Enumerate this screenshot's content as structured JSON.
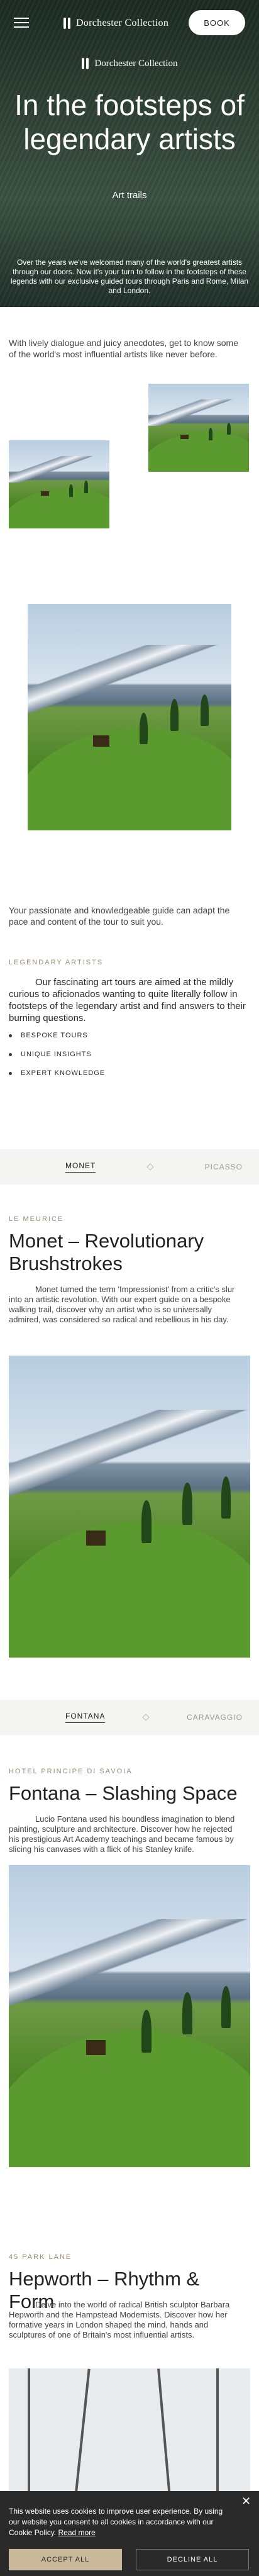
{
  "header": {
    "brand": "Dorchester Collection",
    "book_label": "BOOK",
    "menu_icon": "hamburger-icon"
  },
  "hero": {
    "brand": "Dorchester Collection",
    "title": "In the footsteps of legendary artists",
    "subtitle": "Art trails",
    "description": "Over the years we've welcomed many of the world's greatest artists through our doors. Now it's your turn to follow in the footsteps of these legends with our exclusive guided tours through Paris and Rome, Milan and London."
  },
  "intro": "With lively dialogue and juicy anecdotes, get to know some of the world's most influential artists like never before.",
  "guide_text": "Your passionate and knowledgeable guide can adapt the pace and content of the tour to suit you.",
  "legendary": {
    "kicker": "LEGENDARY ARTISTS",
    "text": "Our fascinating art tours are aimed at the mildly curious to aficionados wanting to quite literally follow in footsteps of the legendary artist and find answers to their burning questions.",
    "features": [
      "BESPOKE TOURS",
      "UNIQUE INSIGHTS",
      "EXPERT KNOWLEDGE"
    ]
  },
  "tabs1": {
    "left": "MONET",
    "right": "PICASSO"
  },
  "monet": {
    "kicker": "LE MEURICE",
    "title": "Monet – Revolutionary Brushstrokes",
    "text": "Monet turned the term 'Impressionist' from a critic's slur into an artistic revolution. With our expert guide on a bespoke walking trail, discover why an artist who is so universally admired, was considered so radical and rebellious in his day."
  },
  "tabs2": {
    "left": "FONTANA",
    "right": "CARAVAGGIO"
  },
  "fontana": {
    "kicker": "HOTEL PRINCIPE DI SAVOIA",
    "title": "Fontana – Slashing Space",
    "text": "Lucio Fontana used his boundless imagination to blend painting, sculpture and architecture. Discover how he rejected his prestigious Art Academy teachings and became famous by slicing his canvases with a flick of his Stanley knife."
  },
  "hepworth": {
    "kicker": "45 PARK LANE",
    "title": "Hepworth – Rhythm & Form",
    "text": "Delve into the world of radical British sculptor Barbara Hepworth and the Hampstead Modernists. Discover how her formative years in London shaped the mind, hands and sculptures of one of Britain's most influential artists."
  },
  "cookie": {
    "text": "This website uses cookies to improve user experience. By using our website you consent to all cookies in accordance with our Cookie Policy.",
    "read_more": "Read more",
    "accept": "ACCEPT ALL",
    "decline": "DECLINE ALL",
    "close_icon": "close-icon"
  }
}
